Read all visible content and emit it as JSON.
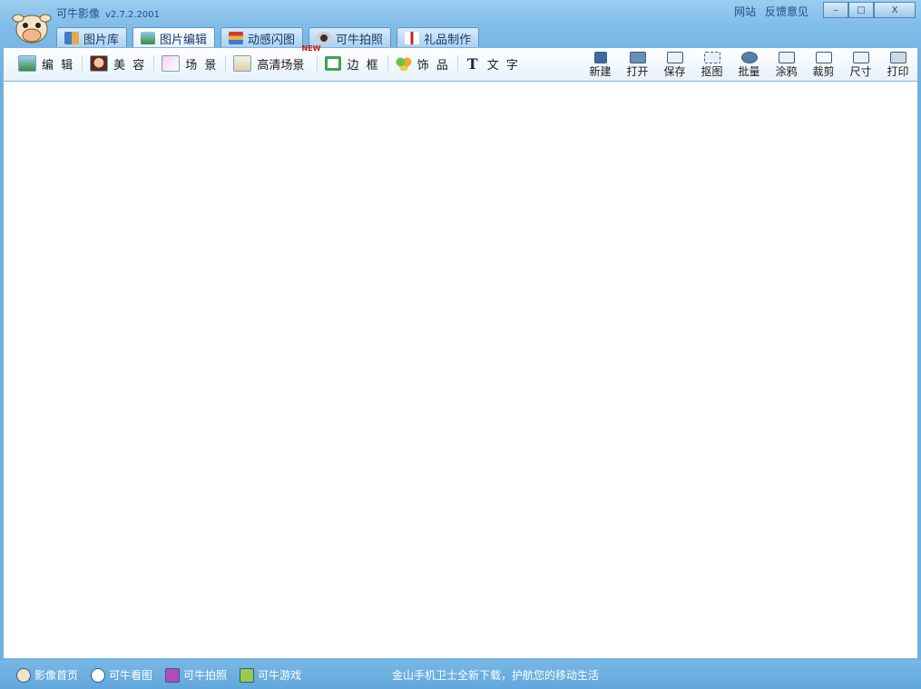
{
  "app": {
    "title": "可牛影像",
    "version": "v2.7.2.2001"
  },
  "top_links": [
    "网站",
    "反馈意见"
  ],
  "window_controls": [
    "–",
    "□",
    "X"
  ],
  "tabs": [
    {
      "label": "图片库",
      "icon": "gallery-icon",
      "active": false
    },
    {
      "label": "图片编辑",
      "icon": "image-edit-icon",
      "active": true
    },
    {
      "label": "动感闪图",
      "icon": "flash-gif-icon",
      "active": false
    },
    {
      "label": "可牛拍照",
      "icon": "webcam-icon",
      "active": false
    },
    {
      "label": "礼品制作",
      "icon": "gift-icon",
      "active": false
    }
  ],
  "toolbar_left": [
    {
      "label": "编 辑",
      "icon": "edit-landscape-icon",
      "new": false
    },
    {
      "label": "美 容",
      "icon": "face-beauty-icon",
      "new": false
    },
    {
      "label": "场 景",
      "icon": "scene-icon",
      "new": false
    },
    {
      "label": "高清场景",
      "icon": "hd-scene-icon",
      "new": true,
      "badge": "NEW"
    },
    {
      "label": "边 框",
      "icon": "border-frame-icon",
      "new": false
    },
    {
      "label": "饰 品",
      "icon": "clover-decoration-icon",
      "new": false
    },
    {
      "label": "文 字",
      "icon": "text-t-icon",
      "new": false
    }
  ],
  "toolbar_right": [
    {
      "label": "新建",
      "icon": "new-file-icon"
    },
    {
      "label": "打开",
      "icon": "open-folder-icon"
    },
    {
      "label": "保存",
      "icon": "save-disk-icon"
    },
    {
      "label": "抠图",
      "icon": "cutout-icon"
    },
    {
      "label": "批量",
      "icon": "batch-gear-icon"
    },
    {
      "label": "涂鸦",
      "icon": "doodle-icon"
    },
    {
      "label": "裁剪",
      "icon": "crop-icon"
    },
    {
      "label": "尺寸",
      "icon": "resize-icon"
    },
    {
      "label": "打印",
      "icon": "printer-icon"
    }
  ],
  "status_bar": {
    "items": [
      {
        "label": "影像首页",
        "icon": "cow-home-icon"
      },
      {
        "label": "可牛看图",
        "icon": "eye-viewer-icon"
      },
      {
        "label": "可牛拍照",
        "icon": "camera-icon"
      },
      {
        "label": "可牛游戏",
        "icon": "game-icon"
      }
    ],
    "ad_text": "金山手机卫士全新下载，护航您的移动生活"
  },
  "colors": {
    "frame": "#6cb0e0",
    "accent": "#1f4f86",
    "canvas": "#ffffff",
    "new_badge": "#d41414"
  }
}
